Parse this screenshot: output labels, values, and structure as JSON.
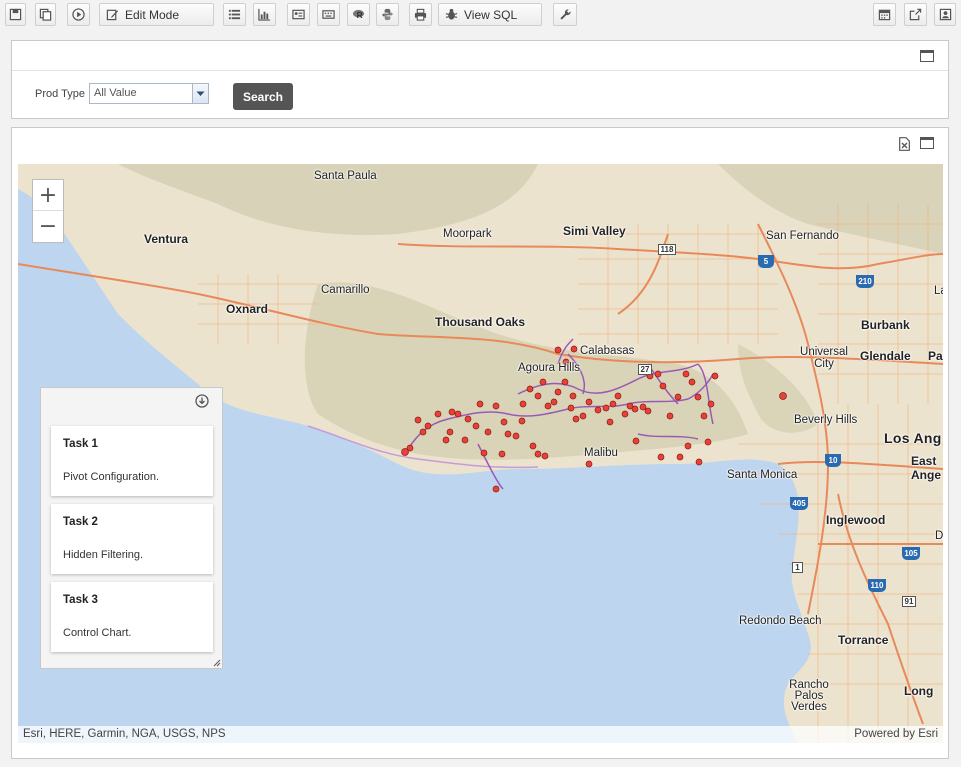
{
  "toolbar": {
    "edit_mode_label": "Edit Mode",
    "view_sql_label": "View SQL"
  },
  "filter": {
    "prod_type_label": "Prod Type",
    "prod_type_value": "All Value",
    "search_label": "Search"
  },
  "map": {
    "places": {
      "santa_paula": "Santa Paula",
      "ventura": "Ventura",
      "moorpark": "Moorpark",
      "simi_valley": "Simi Valley",
      "san_fernando": "San Fernando",
      "camarillo": "Camarillo",
      "oxnard": "Oxnard",
      "thousand_oaks": "Thousand Oaks",
      "burbank": "Burbank",
      "calabasas": "Calabasas",
      "universal_city": "Universal City",
      "glendale": "Glendale",
      "agoura_hills": "Agoura Hills",
      "beverly_hills": "Beverly Hills",
      "los_angeles": "Los Ang",
      "east_la": "East Ange",
      "malibu": "Malibu",
      "santa_monica": "Santa Monica",
      "inglewood": "Inglewood",
      "redondo_beach": "Redondo Beach",
      "torrance": "Torrance",
      "rancho_palos_verdes": "Rancho Palos Verdes",
      "long_beach": "Long",
      "la_edge": "La",
      "pa_edge": "Pa",
      "d_edge": "D"
    },
    "shields": {
      "r118": "118",
      "i5": "5",
      "i210": "210",
      "r27": "27",
      "i10": "10",
      "i405": "405",
      "i105": "105",
      "r1": "1",
      "i110": "110",
      "r91": "91"
    },
    "attribution": "Esri, HERE, Garmin, NGA, USGS, NPS",
    "powered_by": "Powered by Esri"
  },
  "tasks": [
    {
      "title": "Task 1",
      "desc": "Pivot Configuration."
    },
    {
      "title": "Task 2",
      "desc": "Hidden Filtering."
    },
    {
      "title": "Task 3",
      "desc": "Control Chart."
    }
  ],
  "colors": {
    "water": "#bdd5ee",
    "land": "#ece3cf",
    "route": "#9b59b6",
    "marker": "#e8413a"
  }
}
